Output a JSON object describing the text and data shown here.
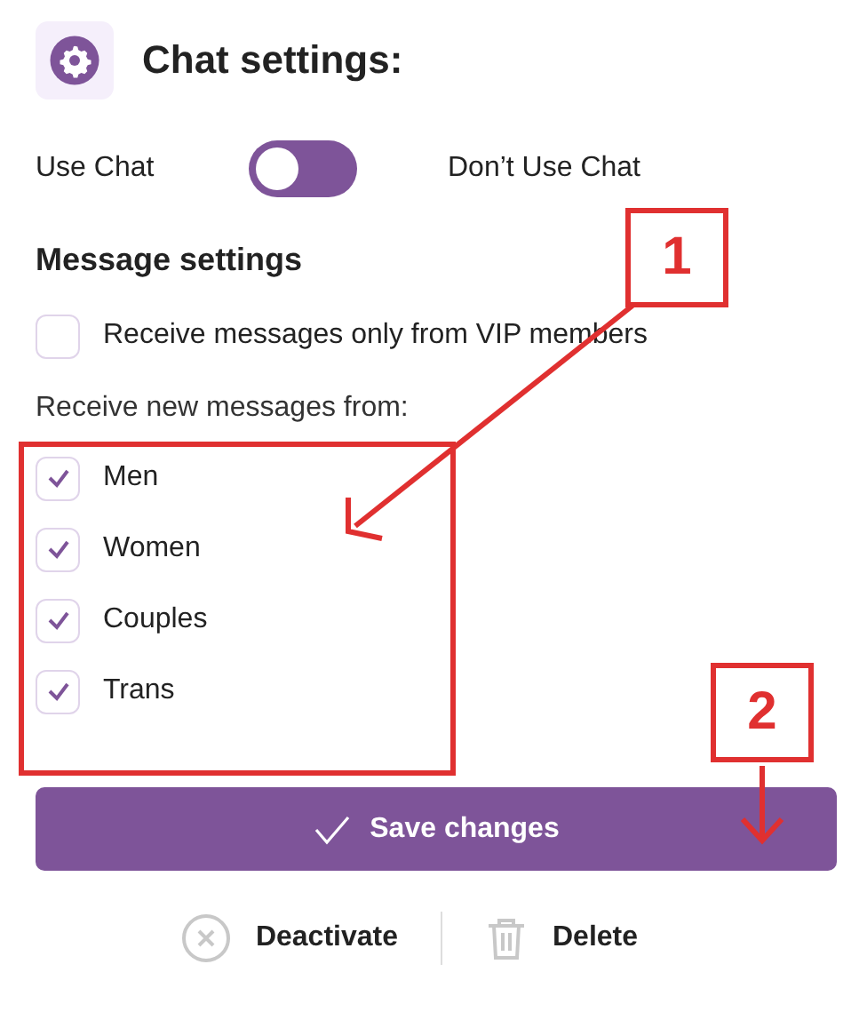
{
  "title": "Chat settings:",
  "chat_toggle": {
    "left_label": "Use Chat",
    "right_label": "Don’t Use Chat",
    "on": false
  },
  "message_settings": {
    "heading": "Message settings",
    "vip_only": {
      "label": "Receive messages only from VIP members",
      "checked": false
    },
    "from_label": "Receive new messages from:",
    "options": [
      {
        "label": "Men",
        "checked": true
      },
      {
        "label": "Women",
        "checked": true
      },
      {
        "label": "Couples",
        "checked": true
      },
      {
        "label": "Trans",
        "checked": true
      }
    ]
  },
  "save_button": "Save changes",
  "actions": [
    {
      "kind": "deactivate",
      "label": "Deactivate"
    },
    {
      "kind": "delete",
      "label": "Delete"
    }
  ],
  "annotations": [
    {
      "label": "1"
    },
    {
      "label": "2"
    }
  ]
}
